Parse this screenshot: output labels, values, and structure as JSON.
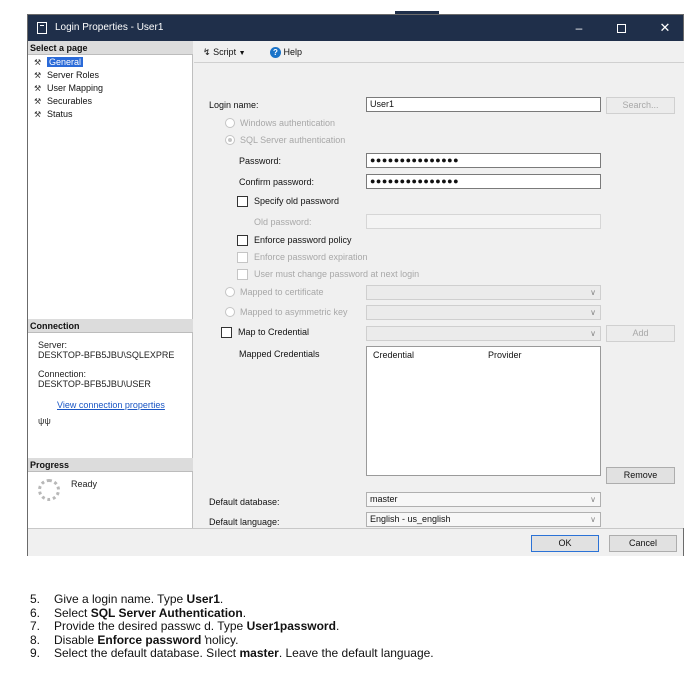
{
  "window": {
    "title": "Login Properties - User1",
    "controls": {
      "minimize": "–",
      "maximize": "",
      "close": "✕"
    }
  },
  "left_pane": {
    "select_page_header": "Select a page",
    "pages": [
      "General",
      "Server Roles",
      "User Mapping",
      "Securables",
      "Status"
    ],
    "selected_page": "General",
    "connection_header": "Connection",
    "server_label": "Server:",
    "server_value": "DESKTOP-BFB5JBU\\SQLEXPRE",
    "connection_label": "Connection:",
    "connection_value": "DESKTOP-BFB5JBU\\USER",
    "view_connection_link": "View connection properties",
    "progress_header": "Progress",
    "progress_status": "Ready"
  },
  "toolbar": {
    "script_label": "Script",
    "script_arrow": "▼",
    "help_label": "Help"
  },
  "general": {
    "login_name_label": "Login name:",
    "login_name_value": "User1",
    "search_button": "Search...",
    "windows_auth": "Windows authentication",
    "sql_auth": "SQL Server authentication",
    "password_label": "Password:",
    "password_value": "●●●●●●●●●●●●●●●",
    "confirm_password_label": "Confirm password:",
    "confirm_password_value": "●●●●●●●●●●●●●●●",
    "specify_old_password": "Specify old password",
    "old_password_label": "Old password:",
    "enforce_policy": "Enforce password policy",
    "enforce_expiration": "Enforce password expiration",
    "must_change": "User must change password at next login",
    "mapped_cert": "Mapped to certificate",
    "mapped_asym": "Mapped to asymmetric key",
    "map_credential": "Map to Credential",
    "add_button": "Add",
    "mapped_credentials_label": "Mapped Credentials",
    "credential_col": "Credential",
    "provider_col": "Provider",
    "remove_button": "Remove",
    "default_db_label": "Default database:",
    "default_db_value": "master",
    "default_lang_label": "Default language:",
    "default_lang_value": "English - us_english"
  },
  "footer": {
    "ok_button": "OK",
    "cancel_button": "Cancel"
  },
  "instructions": [
    {
      "num": "5.",
      "pre": "Give a login name. Type ",
      "bold": "User1",
      "post": "."
    },
    {
      "num": "6.",
      "pre": "Select ",
      "bold": "SQL Server Authentication",
      "post": "."
    },
    {
      "num": "7.",
      "pre": "Provide the desired passwс d. Type ",
      "bold": "User1password",
      "post": "."
    },
    {
      "num": "8.",
      "pre": "Disable ",
      "bold": "Enforce password",
      "post": " ŉolicy."
    },
    {
      "num": "9.",
      "pre": "Select the default database. Sılect ",
      "bold": "master",
      "post": ". Leave the default language."
    }
  ]
}
